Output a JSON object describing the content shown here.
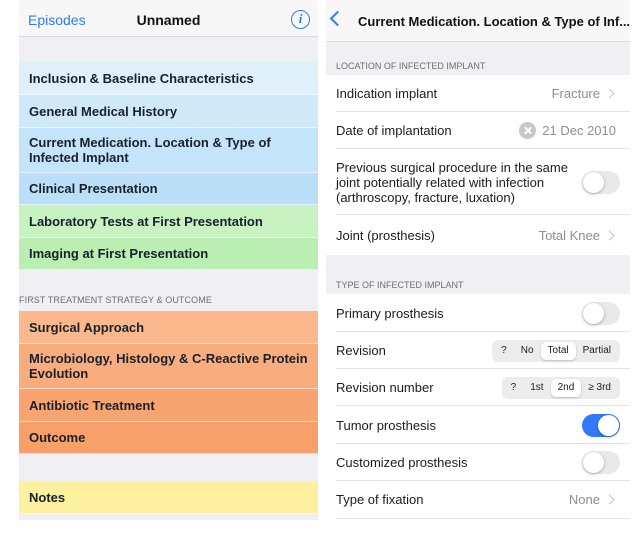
{
  "left": {
    "back_label": "Episodes",
    "title": "Unnamed",
    "info_icon": "info-circle-icon",
    "items": [
      {
        "label": "Inclusion & Baseline Characteristics",
        "color": "#dff0fb"
      },
      {
        "label": "General Medical History",
        "color": "#cfe9fb"
      },
      {
        "label": "Current Medication. Location & Type of Infected Implant",
        "color": "#c4e4fa"
      },
      {
        "label": "Clinical Presentation",
        "color": "#bcdff9"
      },
      {
        "label": "Laboratory Tests at First Presentation",
        "color": "#c8f2c2"
      },
      {
        "label": "Imaging at First Presentation",
        "color": "#baeeb2"
      },
      {
        "label": "Surgical Approach",
        "color": "#fbb88c"
      },
      {
        "label": "Microbiology, Histology & C-Reactive Protein Evolution",
        "color": "#f9ad7e"
      },
      {
        "label": "Antibiotic Treatment",
        "color": "#f8a470"
      },
      {
        "label": "Outcome",
        "color": "#f7a06a"
      },
      {
        "label": "Notes",
        "color": "#fdf1a0"
      }
    ],
    "section_label": "FIRST TREATMENT STRATEGY & OUTCOME"
  },
  "right": {
    "title": "Current Medication. Location & Type of Inf...",
    "sections": [
      {
        "header": "LOCATION OF INFECTED IMPLANT",
        "rows": [
          {
            "label": "Indication implant",
            "value": "Fracture"
          },
          {
            "label": "Date of implantation",
            "value": "21 Dec 2010"
          },
          {
            "label": "Previous surgical procedure in the same joint potentially related with infection (arthroscopy, fracture, luxation)",
            "toggle": false
          },
          {
            "label": "Joint (prosthesis)",
            "value": "Total Knee"
          }
        ]
      },
      {
        "header": "TYPE OF INFECTED IMPLANT",
        "rows": [
          {
            "label": "Primary prosthesis",
            "toggle": false
          },
          {
            "label": "Revision",
            "options": [
              "?",
              "No",
              "Total",
              "Partial"
            ],
            "selected": "Total"
          },
          {
            "label": "Revision number",
            "options": [
              "?",
              "1st",
              "2nd",
              "≥ 3rd"
            ],
            "selected": "2nd"
          },
          {
            "label": "Tumor prosthesis",
            "toggle": true
          },
          {
            "label": "Customized prosthesis",
            "toggle": false
          },
          {
            "label": "Type of fixation",
            "value": "None"
          }
        ]
      }
    ]
  },
  "colors": {
    "accent": "#2f7bf6"
  }
}
